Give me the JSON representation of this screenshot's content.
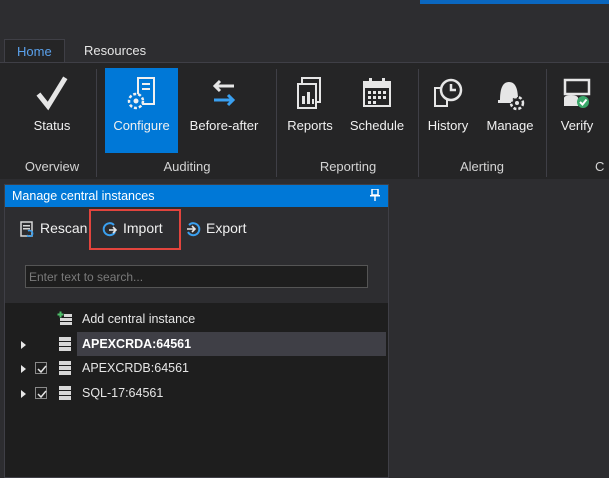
{
  "tabs": [
    {
      "label": "Home",
      "active": true
    },
    {
      "label": "Resources",
      "active": false
    }
  ],
  "ribbon": {
    "buttons": [
      {
        "label": "Status",
        "icon": "checkmark-icon"
      },
      {
        "label": "Configure",
        "icon": "configure-icon",
        "active": true
      },
      {
        "label": "Before-after",
        "icon": "before-after-arrows-icon"
      },
      {
        "label": "Reports",
        "icon": "reports-icon"
      },
      {
        "label": "Schedule",
        "icon": "schedule-calendar-icon"
      },
      {
        "label": "History",
        "icon": "history-icon"
      },
      {
        "label": "Manage",
        "icon": "manage-alert-icon"
      },
      {
        "label": "Verify",
        "icon": "verify-icon"
      }
    ],
    "groups": [
      "Overview",
      "Auditing",
      "Reporting",
      "Alerting",
      "C"
    ]
  },
  "panel": {
    "title": "Manage central instances",
    "toolbar": {
      "rescan": "Rescan",
      "import": "Import",
      "export": "Export"
    },
    "search_placeholder": "Enter text to search...",
    "tree": [
      {
        "label": "Add central instance",
        "type": "add"
      },
      {
        "label": "APEXCRDA:64561",
        "selected": true,
        "bold": true,
        "checked": false
      },
      {
        "label": "APEXCRDB:64561",
        "checked": true
      },
      {
        "label": "SQL-17:64561",
        "checked": true
      }
    ]
  },
  "colors": {
    "accent": "#0078d7",
    "highlight": "#e2443d",
    "background": "#2d2d30"
  }
}
